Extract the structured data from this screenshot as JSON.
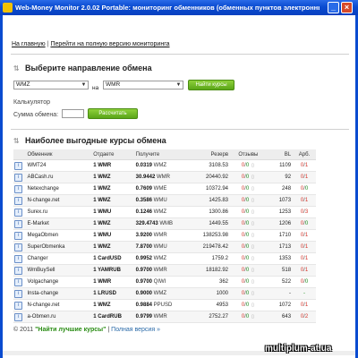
{
  "window": {
    "title": "Web-Money Monitor 2.0.02 Portable: мониторинг обменников (обменных пунктов электронных валют)",
    "minimize_glyph": "_",
    "close_glyph": "×"
  },
  "top_links": {
    "home": "На главную",
    "separator": "|",
    "full_version": "Перейти на полную версию мониторинга"
  },
  "exchange_direction": {
    "title": "Выберите направление обмена",
    "from_value": "WMZ",
    "to_label": "на",
    "to_value": "WMR",
    "find_button": "Найти курсы"
  },
  "calculator": {
    "label": "Калькулятор",
    "sum_label": "Сумма обмена:",
    "sum_value": "",
    "calc_button": "Рассчитать"
  },
  "rates_section": {
    "title": "Наиболее выгодные курсы обмена"
  },
  "table": {
    "headers": [
      "Обменник",
      "Отдаете",
      "Получите",
      "Резерв",
      "Отзывы",
      "BL",
      "Арб."
    ],
    "rows": [
      {
        "name": "WMT24",
        "give": "1 WMR",
        "get_rate": "0.0319",
        "get_cur": "WMZ",
        "reserve": "3108.53",
        "rev_left": "0",
        "rev_right": "0",
        "bl": "1109",
        "arb_left": "0",
        "arb_right": "1"
      },
      {
        "name": "ABCash.ru",
        "give": "1 WMZ",
        "get_rate": "30.9442",
        "get_cur": "WMR",
        "reserve": "20440.92",
        "rev_left": "0",
        "rev_right": "0",
        "bl": "92",
        "arb_left": "0",
        "arb_right": "1"
      },
      {
        "name": "Netexchange",
        "give": "1 WMZ",
        "get_rate": "0.7609",
        "get_cur": "WME",
        "reserve": "10372.94",
        "rev_left": "0",
        "rev_right": "0",
        "bl": "248",
        "arb_left": "0",
        "arb_right": "0"
      },
      {
        "name": "N-change.net",
        "give": "1 WMZ",
        "get_rate": "0.3586",
        "get_cur": "WMU",
        "reserve": "1425.83",
        "rev_left": "0",
        "rev_right": "0",
        "bl": "1073",
        "arb_left": "0",
        "arb_right": "1"
      },
      {
        "name": "Surex.ru",
        "give": "1 WMU",
        "get_rate": "0.1246",
        "get_cur": "WMZ",
        "reserve": "1300.86",
        "rev_left": "0",
        "rev_right": "0",
        "bl": "1253",
        "arb_left": "0",
        "arb_right": "3"
      },
      {
        "name": "E-Market",
        "give": "1 WMZ",
        "get_rate": "329.4743",
        "get_cur": "WMB",
        "reserve": "1449.55",
        "rev_left": "0",
        "rev_right": "0",
        "bl": "1206",
        "arb_left": "0",
        "arb_right": "0"
      },
      {
        "name": "MegaObmen",
        "give": "1 WMU",
        "get_rate": "3.9200",
        "get_cur": "WMR",
        "reserve": "138253.98",
        "rev_left": "0",
        "rev_right": "0",
        "bl": "1710",
        "arb_left": "0",
        "arb_right": "1"
      },
      {
        "name": "SuperObmenka",
        "give": "1 WMZ",
        "get_rate": "7.8700",
        "get_cur": "WMU",
        "reserve": "219478.42",
        "rev_left": "0",
        "rev_right": "0",
        "bl": "1713",
        "arb_left": "0",
        "arb_right": "1"
      },
      {
        "name": "Changer",
        "give": "1 CardUSD",
        "get_rate": "0.9952",
        "get_cur": "WMZ",
        "reserve": "1759.2",
        "rev_left": "0",
        "rev_right": "0",
        "bl": "1353",
        "arb_left": "0",
        "arb_right": "1"
      },
      {
        "name": "WmBuySell",
        "give": "1 YAMRUB",
        "get_rate": "0.9700",
        "get_cur": "WMR",
        "reserve": "18182.92",
        "rev_left": "0",
        "rev_right": "0",
        "bl": "518",
        "arb_left": "0",
        "arb_right": "1"
      },
      {
        "name": "Volgachange",
        "give": "1 WMR",
        "get_rate": "0.9700",
        "get_cur": "QIWI",
        "reserve": "362",
        "rev_left": "0",
        "rev_right": "0",
        "bl": "522",
        "arb_left": "0",
        "arb_right": "0"
      },
      {
        "name": "Insta-change",
        "give": "1 LRUSD",
        "get_rate": "0.9000",
        "get_cur": "WMZ",
        "reserve": "1000",
        "rev_left": "0",
        "rev_right": "0",
        "bl": "-",
        "arb_left": "",
        "arb_right": "-"
      },
      {
        "name": "N-change.net",
        "give": "1 WMZ",
        "get_rate": "0.9884",
        "get_cur": "PPUSD",
        "reserve": "4953",
        "rev_left": "0",
        "rev_right": "0",
        "bl": "1072",
        "arb_left": "0",
        "arb_right": "1"
      },
      {
        "name": "a-Obmen.ru",
        "give": "1 CardRUB",
        "get_rate": "0.9799",
        "get_cur": "WMR",
        "reserve": "2752.27",
        "rev_left": "0",
        "rev_right": "0",
        "bl": "643",
        "arb_left": "0",
        "arb_right": "2"
      }
    ]
  },
  "footer": {
    "copyright": "© 2011",
    "best_rates_link": "\"Найти лучшие курсы\"",
    "separator": "|",
    "full_version_link": "Полная версия »"
  },
  "watermark": "multiplum-at.ua",
  "colors": {
    "titlebar": "#0a4bd0",
    "accent_green": "#5aa518",
    "zero_red": "#d4342a",
    "positive_green": "#1a8c1a"
  }
}
